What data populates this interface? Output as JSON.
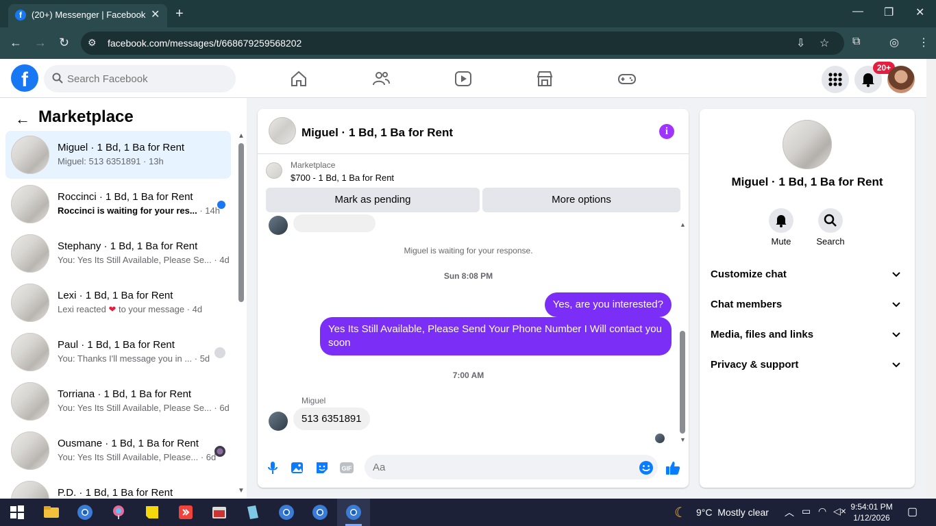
{
  "browser": {
    "tab_title": "(20+) Messenger | Facebook",
    "favicon_letter": "f",
    "url": "facebook.com/messages/t/668679259568202"
  },
  "topnav": {
    "search_placeholder": "Search Facebook",
    "notif_badge": "20+"
  },
  "sidebar": {
    "heading": "Marketplace",
    "conversations": [
      {
        "name": "Miguel · 1 Bd, 1 Ba for Rent",
        "preview": "Miguel: 513 6351891 · 13h",
        "active": true
      },
      {
        "name": "Roccinci · 1 Bd, 1 Ba for Rent",
        "preview": "Roccinci is waiting for your res...",
        "time": " · 14h",
        "unread": true
      },
      {
        "name": "Stephany · 1 Bd, 1 Ba for Rent",
        "preview": "You: Yes Its Still Available, Please Se... · 4d"
      },
      {
        "name": "Lexi · 1 Bd, 1 Ba for Rent",
        "preview_pre": "Lexi reacted ",
        "preview_post": " to your message · 4d"
      },
      {
        "name": "Paul · 1 Bd, 1 Ba for Rent",
        "preview": "You: Thanks I'll message you in ... · 5d"
      },
      {
        "name": "Torriana · 1 Bd, 1 Ba for Rent",
        "preview": "You: Yes Its Still Available, Please Se... · 6d"
      },
      {
        "name": "Ousmane · 1 Bd, 1 Ba for Rent",
        "preview": "You: Yes Its Still Available, Please... · 6d"
      },
      {
        "name": "P.D. · 1 Bd, 1 Ba for Rent",
        "preview": ""
      }
    ]
  },
  "chat": {
    "title": "Miguel · 1 Bd, 1 Ba for Rent",
    "marketplace_label": "Marketplace",
    "listing": "$700 - 1 Bd, 1 Ba for Rent",
    "mark_pending": "Mark as pending",
    "more_options": "More options",
    "system_msg": "Miguel is waiting for your response.",
    "stamp1": "Sun 8:08 PM",
    "out1": "Yes, are you interested?",
    "out2": "Yes Its Still Available, Please Send Your Phone Number I Will contact you soon",
    "stamp2": "7:00 AM",
    "sender": "Miguel",
    "in1": "513 6351891",
    "input_placeholder": "Aa",
    "accent_color": "#7a2ef6"
  },
  "details": {
    "name": "Miguel · 1 Bd, 1 Ba for Rent",
    "mute": "Mute",
    "search": "Search",
    "sections": [
      "Customize chat",
      "Chat members",
      "Media, files and links",
      "Privacy & support"
    ]
  },
  "taskbar": {
    "temp": "9°C",
    "weather": "Mostly clear",
    "time": "9:54:01 PM",
    "date": "1/12/2026"
  }
}
